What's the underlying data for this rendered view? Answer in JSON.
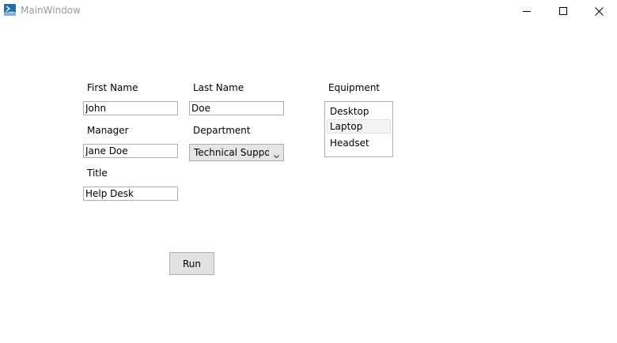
{
  "window": {
    "title": "MainWindow",
    "icon": "powershell-icon",
    "controls": [
      "minimize-icon",
      "maximize-icon",
      "close-icon"
    ]
  },
  "form": {
    "first_name": {
      "label": "First Name",
      "value": "John"
    },
    "last_name": {
      "label": "Last Name",
      "value": "Doe"
    },
    "manager": {
      "label": "Manager",
      "value": "Jane Doe"
    },
    "department": {
      "label": "Department",
      "selected": "Technical Support"
    },
    "title": {
      "label": "Title",
      "value": "Help Desk"
    },
    "equipment": {
      "label": "Equipment",
      "items": [
        "Desktop",
        "Laptop",
        "Headset"
      ],
      "hovered_index": 1
    }
  },
  "actions": {
    "run_label": "Run"
  },
  "colors": {
    "button_bg": "#e1e1e1",
    "combo_bg": "#e5e5e5",
    "border": "#abadb3",
    "title_text": "#999999",
    "icon_blue": "#1f6fb2"
  }
}
